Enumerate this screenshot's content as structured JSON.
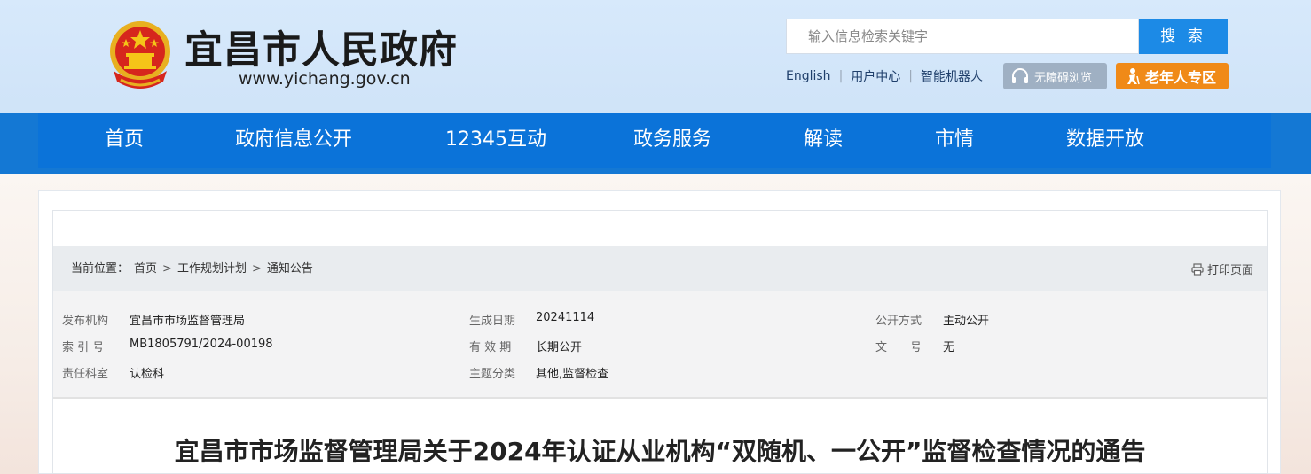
{
  "header": {
    "site_name": "宜昌市人民政府",
    "site_url": "www.yichang.gov.cn",
    "search": {
      "placeholder": "输入信息检索关键字",
      "button_label": "搜 索"
    },
    "util_links": [
      "English",
      "用户中心",
      "智能机器人"
    ],
    "accessibility_label": "无障碍浏览",
    "elderly_label": "老年人专区"
  },
  "nav": {
    "items": [
      "首页",
      "政府信息公开",
      "12345互动",
      "政务服务",
      "解读",
      "市情",
      "数据开放"
    ]
  },
  "breadcrumb": {
    "prefix": "当前位置：",
    "items": [
      "首页",
      "工作规划计划",
      "通知公告"
    ],
    "separator": ">",
    "print_label": "打印页面"
  },
  "meta": {
    "publisher_label": "发布机构",
    "publisher": "宜昌市市场监督管理局",
    "index_label": "索 引 号",
    "index": "MB1805791/2024-00198",
    "dept_label": "责任科室",
    "dept": "认检科",
    "date_label": "生成日期",
    "date": "20241114",
    "validity_label": "有 效 期",
    "validity": "长期公开",
    "topic_label": "主题分类",
    "topic": "其他,监督检查",
    "disclosure_label": "公开方式",
    "disclosure": "主动公开",
    "docno_label": "文　　号",
    "docno": "无"
  },
  "article": {
    "title": "宜昌市市场监督管理局关于2024年认证从业机构“双随机、一公开”监督检查情况的通告"
  },
  "colors": {
    "header_bg": "#d7e9fb",
    "nav_bg": "#0b73d9",
    "search_button": "#1c8ae6",
    "elderly_button": "#f08a18",
    "accessibility_button": "#9fb0c3"
  }
}
